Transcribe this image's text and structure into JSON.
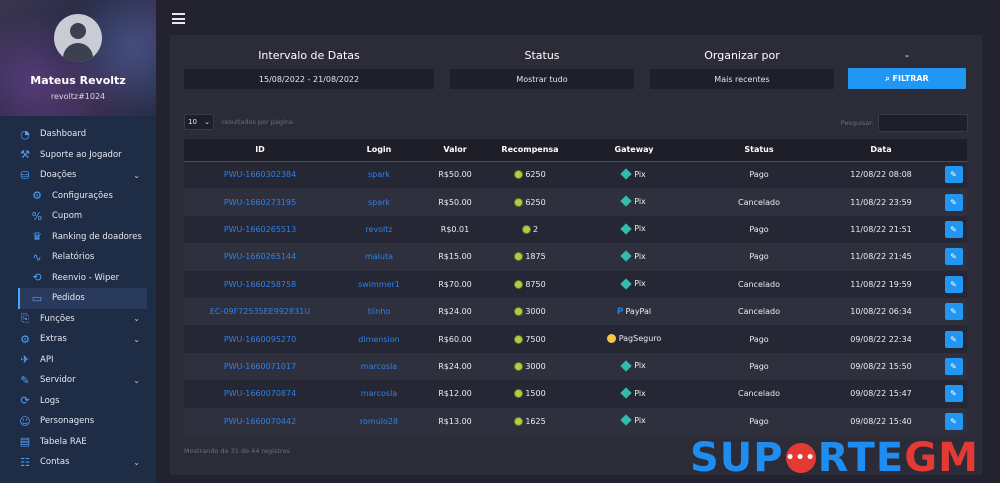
{
  "profile": {
    "name": "Mateus Revoltz",
    "username": "revoltz#1024"
  },
  "sidebar": {
    "items": [
      {
        "label": "Dashboard",
        "icon": "◔",
        "chevron": ""
      },
      {
        "label": "Suporte ao Jogador",
        "icon": "⚒",
        "chevron": ""
      },
      {
        "label": "Doações",
        "icon": "⛁",
        "chevron": "⌄"
      },
      {
        "label": "Configurações",
        "icon": "⚙",
        "chevron": ""
      },
      {
        "label": "Cupom",
        "icon": "%",
        "chevron": ""
      },
      {
        "label": "Ranking de doadores",
        "icon": "♛",
        "chevron": ""
      },
      {
        "label": "Relatórios",
        "icon": "∿",
        "chevron": ""
      },
      {
        "label": "Reenvio - Wiper",
        "icon": "⟲",
        "chevron": ""
      },
      {
        "label": "Pedidos",
        "icon": "▭",
        "chevron": ""
      },
      {
        "label": "Funções",
        "icon": "⎘",
        "chevron": "⌄"
      },
      {
        "label": "Extras",
        "icon": "⚙",
        "chevron": "⌄"
      },
      {
        "label": "API",
        "icon": "✈",
        "chevron": ""
      },
      {
        "label": "Servidor",
        "icon": "✎",
        "chevron": "⌄"
      },
      {
        "label": "Logs",
        "icon": "⟳",
        "chevron": ""
      },
      {
        "label": "Personagens",
        "icon": "☺",
        "chevron": ""
      },
      {
        "label": "Tabela RAE",
        "icon": "▤",
        "chevron": ""
      },
      {
        "label": "Contas",
        "icon": "☷",
        "chevron": "⌄"
      }
    ]
  },
  "filters": {
    "date": {
      "label": "Intervalo de Datas",
      "value": "15/08/2022 - 21/08/2022"
    },
    "status": {
      "label": "Status",
      "value": "Mostrar tudo"
    },
    "order": {
      "label": "Organizar por",
      "value": "Mais recentes"
    },
    "extra": {
      "label": "-"
    },
    "button": "⌕ FILTRAR"
  },
  "table_controls": {
    "page_length": "10",
    "page_length_text": "resultados por página",
    "search_label": "Pesquisar:"
  },
  "table": {
    "headers": [
      "ID",
      "Login",
      "Valor",
      "Recompensa",
      "Gateway",
      "Status",
      "Data"
    ],
    "rows": [
      {
        "id": "PWU-1660302384",
        "login": "spark",
        "valor": "R$50.00",
        "recompensa": "6250",
        "gateway": "Pix",
        "gw": "pix",
        "status": "Pago",
        "data": "12/08/22 08:08"
      },
      {
        "id": "PWU-1660273195",
        "login": "spark",
        "valor": "R$50.00",
        "recompensa": "6250",
        "gateway": "Pix",
        "gw": "pix",
        "status": "Cancelado",
        "data": "11/08/22 23:59"
      },
      {
        "id": "PWU-1660265513",
        "login": "revoltz",
        "valor": "R$0.01",
        "recompensa": "2",
        "gateway": "Pix",
        "gw": "pix",
        "status": "Pago",
        "data": "11/08/22 21:51"
      },
      {
        "id": "PWU-1660265144",
        "login": "maluta",
        "valor": "R$15.00",
        "recompensa": "1875",
        "gateway": "Pix",
        "gw": "pix",
        "status": "Pago",
        "data": "11/08/22 21:45"
      },
      {
        "id": "PWU-1660258758",
        "login": "swimmer1",
        "valor": "R$70.00",
        "recompensa": "8750",
        "gateway": "Pix",
        "gw": "pix",
        "status": "Cancelado",
        "data": "11/08/22 19:59"
      },
      {
        "id": "EC-09F72535EE992831U",
        "login": "tiinho",
        "valor": "R$24.00",
        "recompensa": "3000",
        "gateway": "PayPal",
        "gw": "paypal",
        "status": "Cancelado",
        "data": "10/08/22 06:34"
      },
      {
        "id": "PWU-1660095270",
        "login": "dimension",
        "valor": "R$60.00",
        "recompensa": "7500",
        "gateway": "PagSeguro",
        "gw": "pagseguro",
        "status": "Pago",
        "data": "09/08/22 22:34"
      },
      {
        "id": "PWU-1660071017",
        "login": "marcosla",
        "valor": "R$24.00",
        "recompensa": "3000",
        "gateway": "Pix",
        "gw": "pix",
        "status": "Pago",
        "data": "09/08/22 15:50"
      },
      {
        "id": "PWU-1660070874",
        "login": "marcosla",
        "valor": "R$12.00",
        "recompensa": "1500",
        "gateway": "Pix",
        "gw": "pix",
        "status": "Cancelado",
        "data": "09/08/22 15:47"
      },
      {
        "id": "PWU-1660070442",
        "login": "romulo28",
        "valor": "R$13.00",
        "recompensa": "1625",
        "gateway": "Pix",
        "gw": "pix",
        "status": "Pago",
        "data": "09/08/22 15:40"
      }
    ],
    "info": "Mostrando de 31 de 44 registros"
  },
  "watermark": {
    "part1": "SUP",
    "part2": "RTE",
    "part3": "GM",
    "bubble": "•••"
  },
  "colors": {
    "accent": "#2196f3",
    "link": "#2f80e6",
    "pix": "#32bcad",
    "sidebar": "#1f2c45"
  }
}
